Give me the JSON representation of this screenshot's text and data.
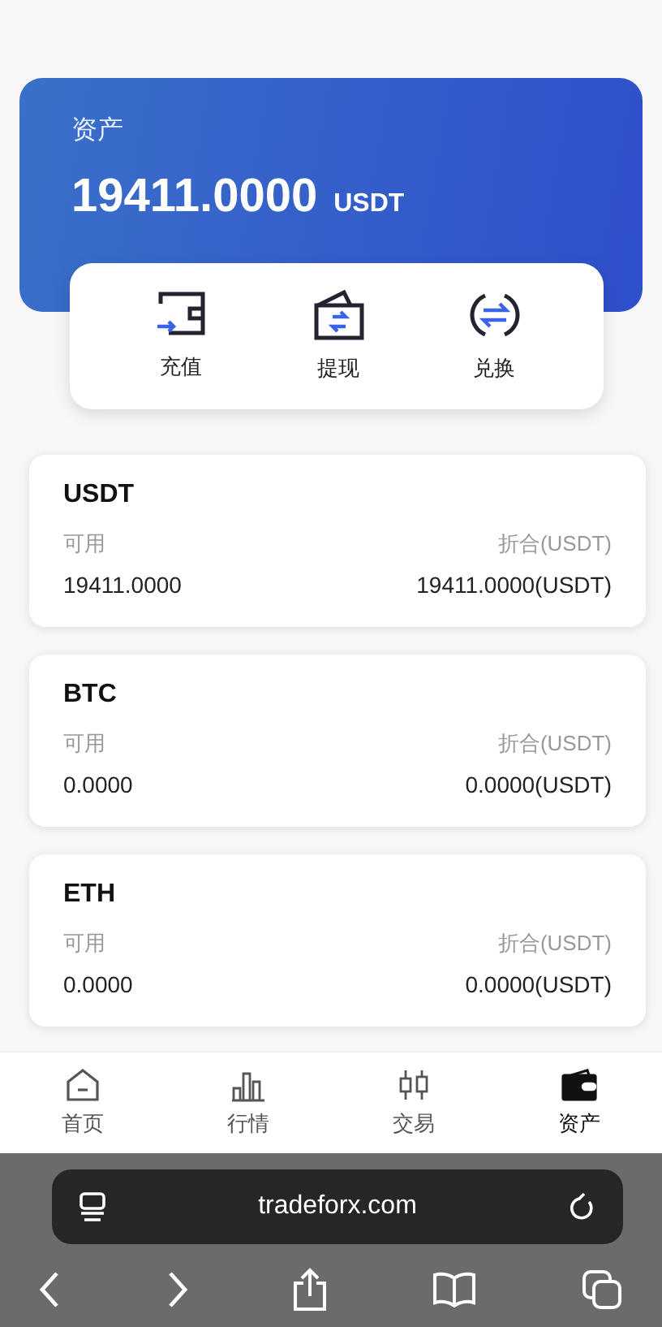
{
  "summary": {
    "label": "资产",
    "amount": "19411.0000",
    "unit": "USDT"
  },
  "actions": [
    {
      "kind": "deposit",
      "label": "充值"
    },
    {
      "kind": "withdraw",
      "label": "提现"
    },
    {
      "kind": "exchange",
      "label": "兑换"
    }
  ],
  "assets": [
    {
      "name": "USDT",
      "available_label": "可用",
      "available": "19411.0000",
      "converted_label": "折合(USDT)",
      "converted": "19411.0000(USDT)"
    },
    {
      "name": "BTC",
      "available_label": "可用",
      "available": "0.0000",
      "converted_label": "折合(USDT)",
      "converted": "0.0000(USDT)"
    },
    {
      "name": "ETH",
      "available_label": "可用",
      "available": "0.0000",
      "converted_label": "折合(USDT)",
      "converted": "0.0000(USDT)"
    }
  ],
  "tab_bar": [
    {
      "kind": "home",
      "label": "首页",
      "selected": false
    },
    {
      "kind": "market",
      "label": "行情",
      "selected": false
    },
    {
      "kind": "trade",
      "label": "交易",
      "selected": false
    },
    {
      "kind": "assets",
      "label": "资产",
      "selected": true
    }
  ],
  "browser": {
    "url": "tradeforx.com"
  }
}
